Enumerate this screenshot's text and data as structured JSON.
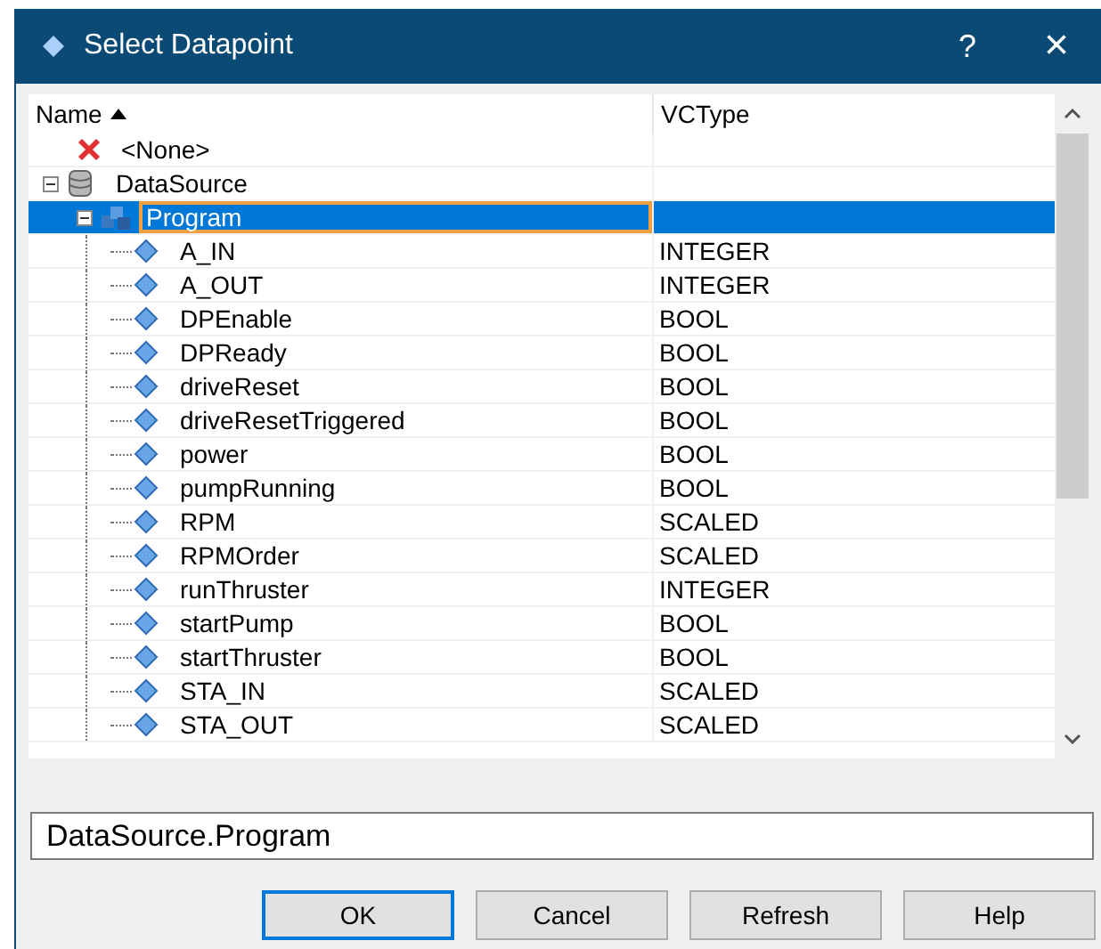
{
  "window": {
    "title": "Select Datapoint",
    "help": "?",
    "close": "×"
  },
  "table": {
    "columns": [
      {
        "label": "Name",
        "sorted": true
      },
      {
        "label": "VCType",
        "sorted": false
      }
    ],
    "rows": [
      {
        "kind": "none",
        "name": "<None>",
        "selected": false
      },
      {
        "kind": "source",
        "name": "DataSource",
        "selected": false,
        "expanded": true,
        "children": [
          {
            "kind": "program",
            "name": "Program",
            "selected": true,
            "expanded": true,
            "children": [
              {
                "kind": "point",
                "name": "A_IN",
                "type": "INTEGER",
                "selected": false
              },
              {
                "kind": "point",
                "name": "A_OUT",
                "type": "INTEGER",
                "selected": false
              },
              {
                "kind": "point",
                "name": "DPEnable",
                "type": "BOOL",
                "selected": false
              },
              {
                "kind": "point",
                "name": "DPReady",
                "type": "BOOL",
                "selected": false
              },
              {
                "kind": "point",
                "name": "driveReset",
                "type": "BOOL",
                "selected": false
              },
              {
                "kind": "point",
                "name": "driveResetTriggered",
                "type": "BOOL",
                "selected": false
              },
              {
                "kind": "point",
                "name": "power",
                "type": "BOOL",
                "selected": false
              },
              {
                "kind": "point",
                "name": "pumpRunning",
                "type": "BOOL",
                "selected": false
              },
              {
                "kind": "point",
                "name": "RPM",
                "type": "SCALED",
                "selected": false
              },
              {
                "kind": "point",
                "name": "RPMOrder",
                "type": "SCALED",
                "selected": false
              },
              {
                "kind": "point",
                "name": "runThruster",
                "type": "INTEGER",
                "selected": false
              },
              {
                "kind": "point",
                "name": "startPump",
                "type": "BOOL",
                "selected": false
              },
              {
                "kind": "point",
                "name": "startThruster",
                "type": "BOOL",
                "selected": false
              },
              {
                "kind": "point",
                "name": "STA_IN",
                "type": "SCALED",
                "selected": false
              },
              {
                "kind": "point",
                "name": "STA_OUT",
                "type": "SCALED",
                "selected": false
              }
            ]
          }
        ]
      }
    ]
  },
  "path_field": {
    "value": "DataSource.Program"
  },
  "buttons": [
    {
      "label": "OK",
      "default": true
    },
    {
      "label": "Cancel",
      "default": false
    },
    {
      "label": "Refresh",
      "default": false
    },
    {
      "label": "Help",
      "default": false
    }
  ]
}
